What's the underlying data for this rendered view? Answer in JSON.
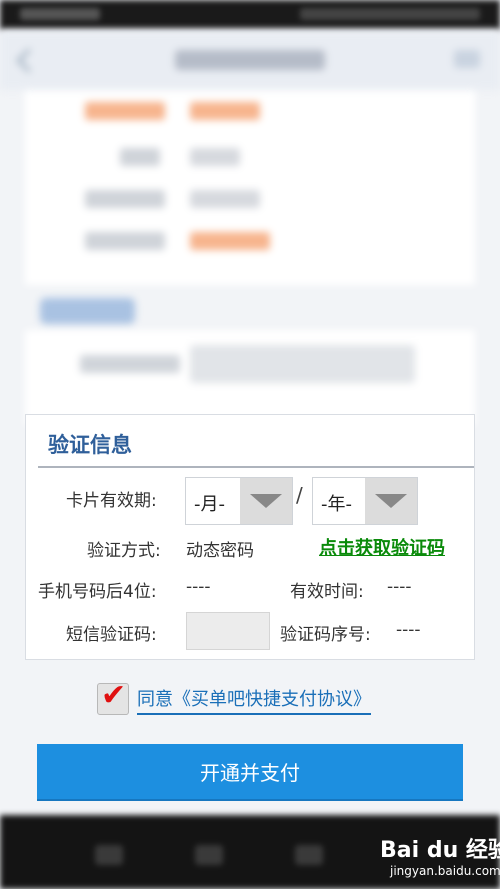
{
  "verify": {
    "title": "验证信息",
    "expiry_label": "卡片有效期:",
    "month_select": "-月-",
    "slash": "/",
    "year_select": "-年-",
    "method_label": "验证方式:",
    "method_value": "动态密码",
    "get_code": "点击获取验证码",
    "phone_label": "手机号码后4位:",
    "phone_value": "----",
    "valid_time_label": "有效时间:",
    "valid_time_value": "----",
    "sms_label": "短信验证码:",
    "sms_value": "",
    "serial_label": "验证码序号:",
    "serial_value": "----"
  },
  "agreement": {
    "checked": true,
    "text": "同意《买单吧快捷支付协议》"
  },
  "pay_button": "开通并支付",
  "watermark": {
    "logo": "Bai du 经验",
    "url": "jingyan.baidu.com"
  },
  "colors": {
    "title_blue": "#2f5f9a",
    "link_green": "#0a8a0a",
    "link_blue": "#1a6fb8",
    "button_blue": "#1d8fe0",
    "check_red": "#e01010"
  }
}
